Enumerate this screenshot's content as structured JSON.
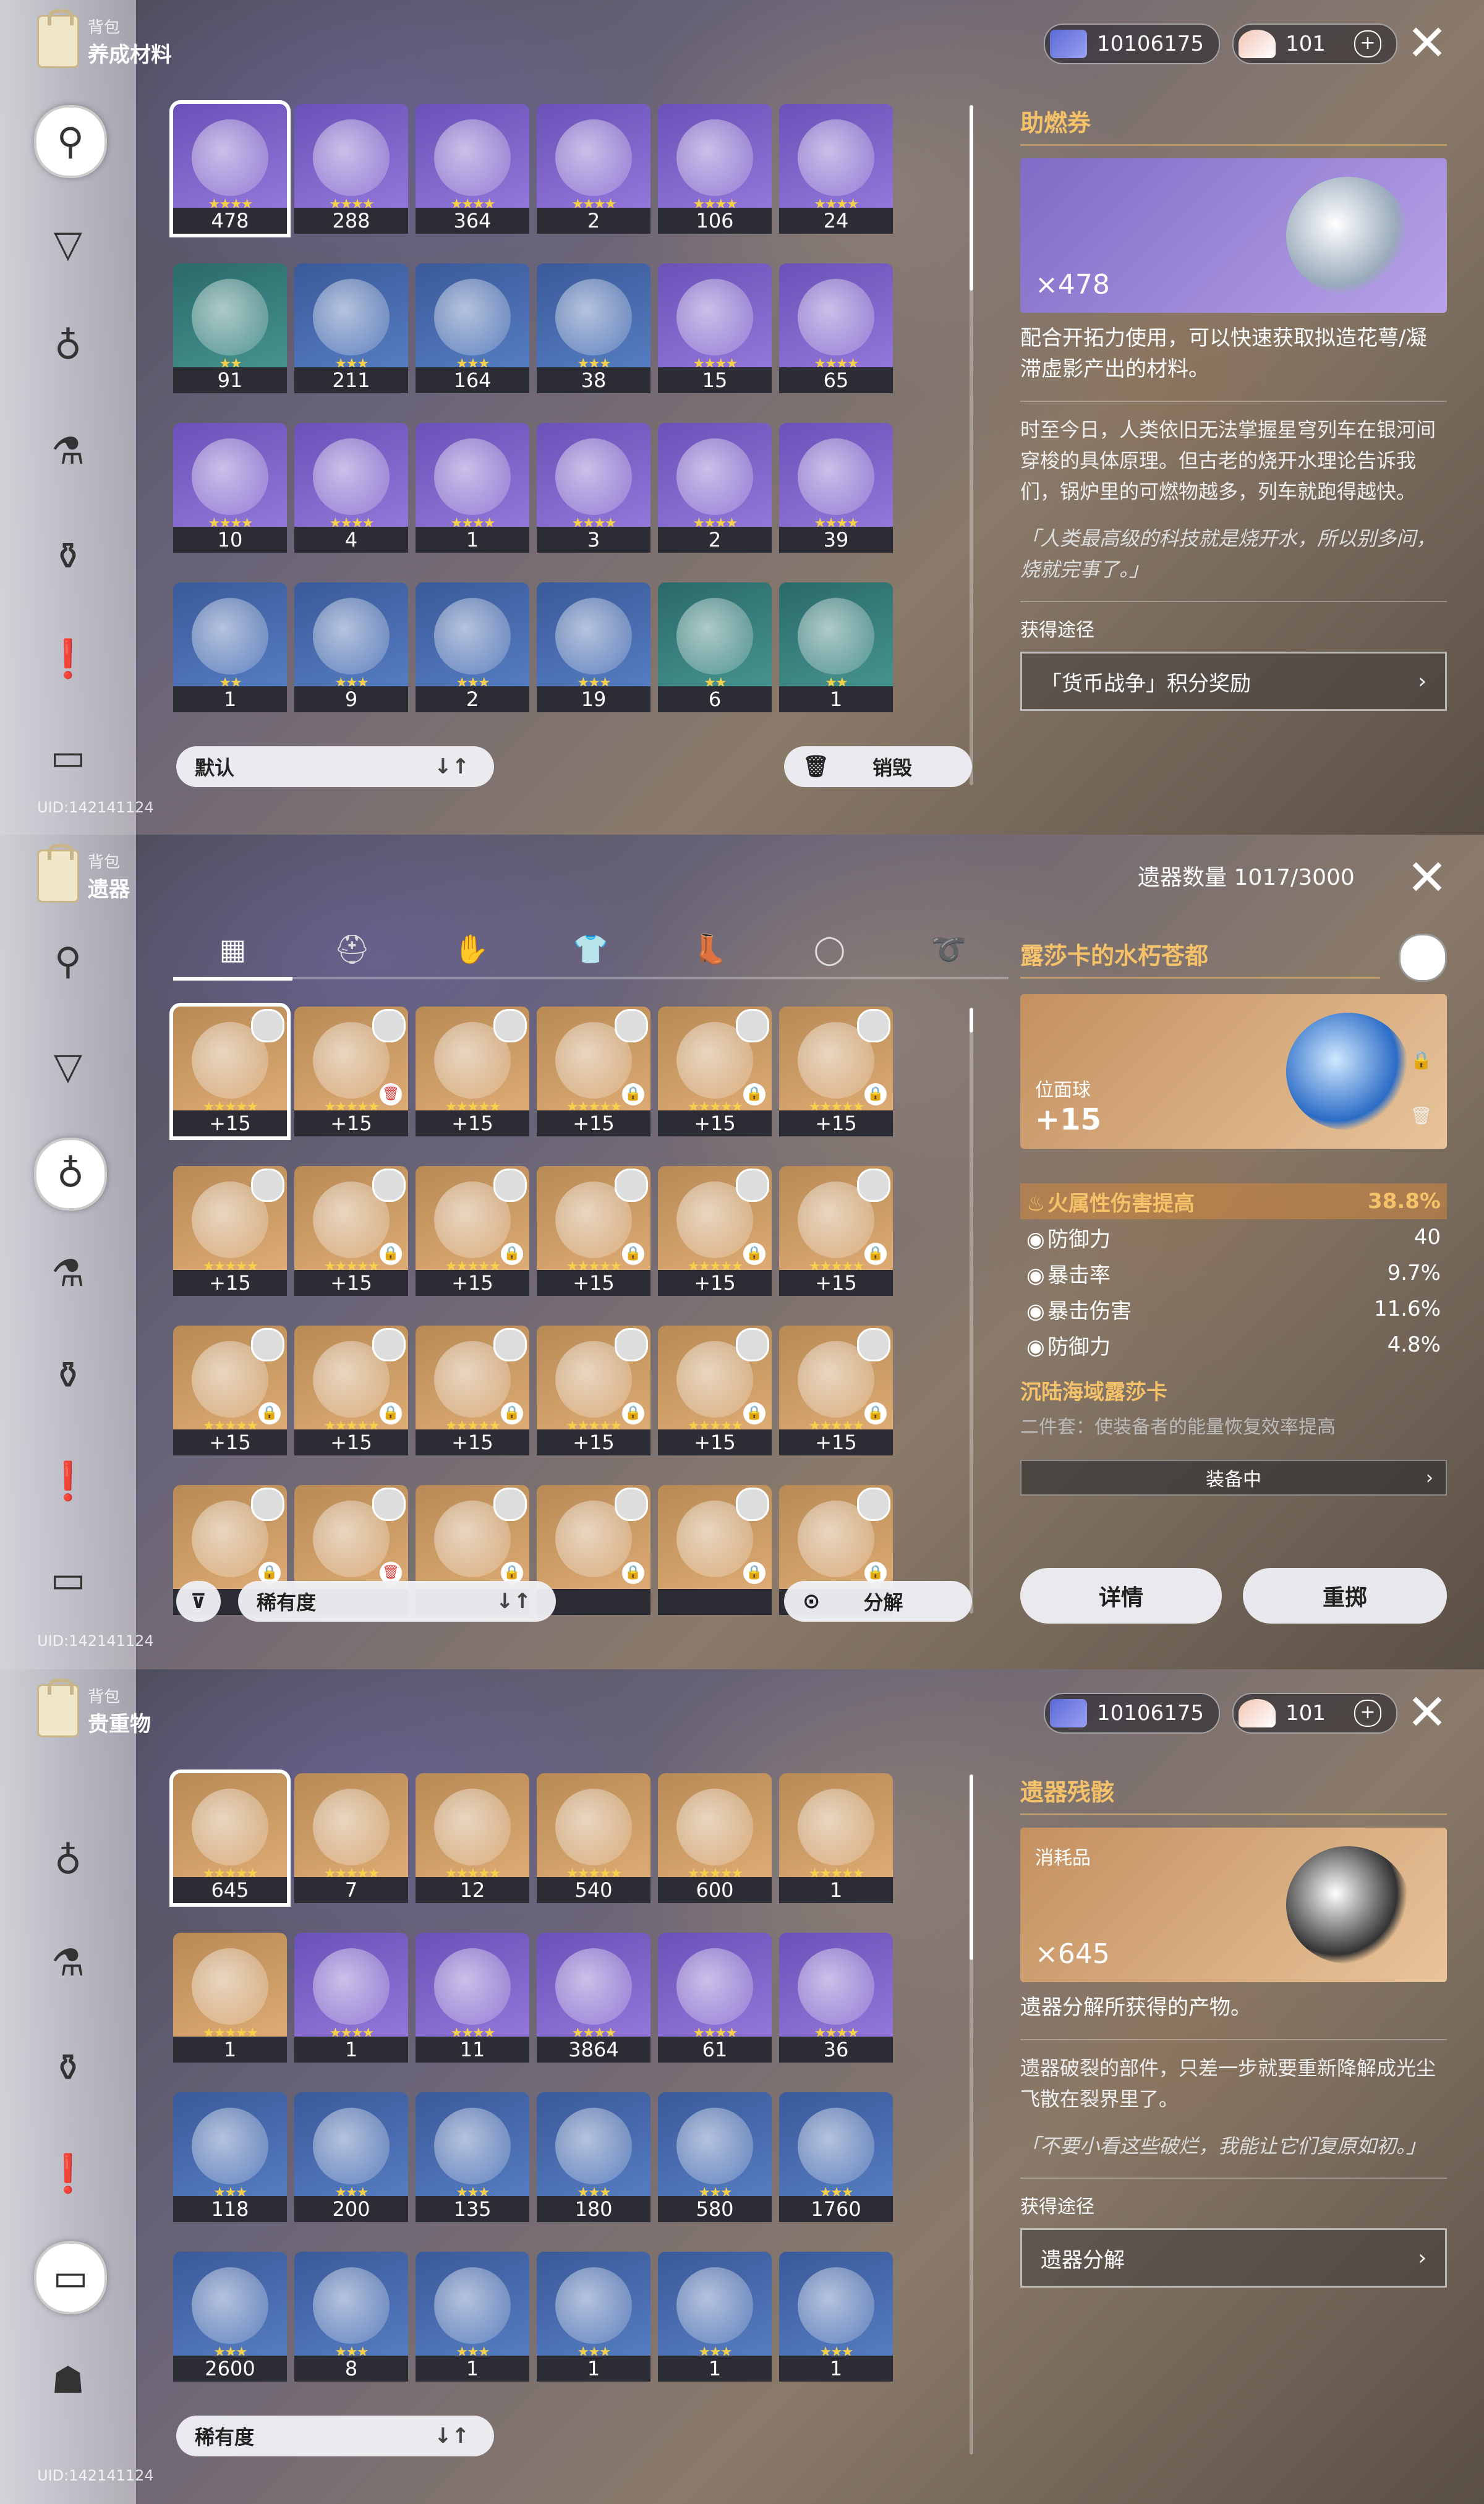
{
  "panel1": {
    "header": {
      "sub": "背包",
      "title": "养成材料"
    },
    "currency": {
      "credits": "10106175",
      "jade": "101",
      "plus": "+"
    },
    "uid": "UID:142141124",
    "sort": {
      "label": "默认",
      "icon": "↓↑"
    },
    "destroy": {
      "label": "销毁"
    },
    "items": [
      {
        "count": "478",
        "rarity": "r4",
        "stars": "★★★★"
      },
      {
        "count": "288",
        "rarity": "r4",
        "stars": "★★★★"
      },
      {
        "count": "364",
        "rarity": "r4",
        "stars": "★★★★"
      },
      {
        "count": "2",
        "rarity": "r4",
        "stars": "★★★★"
      },
      {
        "count": "106",
        "rarity": "r4",
        "stars": "★★★★"
      },
      {
        "count": "24",
        "rarity": "r4",
        "stars": "★★★★"
      },
      {
        "count": "91",
        "rarity": "r2",
        "stars": "★★"
      },
      {
        "count": "211",
        "rarity": "r3",
        "stars": "★★★"
      },
      {
        "count": "164",
        "rarity": "r3",
        "stars": "★★★"
      },
      {
        "count": "38",
        "rarity": "r3",
        "stars": "★★★"
      },
      {
        "count": "15",
        "rarity": "r4",
        "stars": "★★★★"
      },
      {
        "count": "65",
        "rarity": "r4",
        "stars": "★★★★"
      },
      {
        "count": "10",
        "rarity": "r4",
        "stars": "★★★★"
      },
      {
        "count": "4",
        "rarity": "r4",
        "stars": "★★★★"
      },
      {
        "count": "1",
        "rarity": "r4",
        "stars": "★★★★"
      },
      {
        "count": "3",
        "rarity": "r4",
        "stars": "★★★★"
      },
      {
        "count": "2",
        "rarity": "r4",
        "stars": "★★★★"
      },
      {
        "count": "39",
        "rarity": "r4",
        "stars": "★★★★"
      },
      {
        "count": "1",
        "rarity": "r3",
        "stars": "★★"
      },
      {
        "count": "9",
        "rarity": "r3",
        "stars": "★★★"
      },
      {
        "count": "2",
        "rarity": "r3",
        "stars": "★★★"
      },
      {
        "count": "19",
        "rarity": "r3",
        "stars": "★★★"
      },
      {
        "count": "6",
        "rarity": "r2",
        "stars": "★★"
      },
      {
        "count": "1",
        "rarity": "r2",
        "stars": "★★"
      }
    ],
    "detail": {
      "title": "助燃券",
      "qty": "×478",
      "text": "配合开拓力使用，可以快速获取拟造花萼/凝滞虚影产出的材料。",
      "lore": "时至今日，人类依旧无法掌握星穹列车在银河间穿梭的具体原理。但古老的烧开水理论告诉我们，锅炉里的可燃物越多，列车就跑得越快。",
      "quote": "「人类最高级的科技就是烧开水，所以别多问，烧就完事了。」",
      "source_label": "获得途径",
      "source_btn": "「货币战争」积分奖励",
      "chev": "›"
    }
  },
  "panel2": {
    "header": {
      "sub": "背包",
      "title": "遗器"
    },
    "count_label": "遗器数量 1017/3000",
    "uid": "UID:142141124",
    "tabs": [
      {
        "name": "all",
        "icon": "▦"
      },
      {
        "name": "head",
        "icon": "⛑"
      },
      {
        "name": "hands",
        "icon": "✋"
      },
      {
        "name": "body",
        "icon": "👕"
      },
      {
        "name": "feet",
        "icon": "👢"
      },
      {
        "name": "sphere",
        "icon": "◯"
      },
      {
        "name": "rope",
        "icon": "➰"
      }
    ],
    "sort": {
      "label": "稀有度",
      "icon": "↓↑"
    },
    "salvage": {
      "label": "分解"
    },
    "items": [
      {
        "count": "+15",
        "rarity": "r5",
        "stars": "★★★★★",
        "badge": ""
      },
      {
        "count": "+15",
        "rarity": "r5",
        "stars": "★★★★★",
        "badge": "🗑"
      },
      {
        "count": "+15",
        "rarity": "r5",
        "stars": "★★★★★",
        "badge": ""
      },
      {
        "count": "+15",
        "rarity": "r5",
        "stars": "★★★★★",
        "badge": "🔒"
      },
      {
        "count": "+15",
        "rarity": "r5",
        "stars": "★★★★★",
        "badge": "🔒"
      },
      {
        "count": "+15",
        "rarity": "r5",
        "stars": "★★★★★",
        "badge": "🔒"
      },
      {
        "count": "+15",
        "rarity": "r5",
        "stars": "★★★★★",
        "badge": ""
      },
      {
        "count": "+15",
        "rarity": "r5",
        "stars": "★★★★★",
        "badge": "🔒"
      },
      {
        "count": "+15",
        "rarity": "r5",
        "stars": "★★★★★",
        "badge": "🔒"
      },
      {
        "count": "+15",
        "rarity": "r5",
        "stars": "★★★★★",
        "badge": "🔒"
      },
      {
        "count": "+15",
        "rarity": "r5",
        "stars": "★★★★★",
        "badge": "🔒"
      },
      {
        "count": "+15",
        "rarity": "r5",
        "stars": "★★★★★",
        "badge": "🔒"
      },
      {
        "count": "+15",
        "rarity": "r5",
        "stars": "★★★★★",
        "badge": "🔒"
      },
      {
        "count": "+15",
        "rarity": "r5",
        "stars": "★★★★★",
        "badge": "🔒"
      },
      {
        "count": "+15",
        "rarity": "r5",
        "stars": "★★★★★",
        "badge": "🔒"
      },
      {
        "count": "+15",
        "rarity": "r5",
        "stars": "★★★★★",
        "badge": "🔒"
      },
      {
        "count": "+15",
        "rarity": "r5",
        "stars": "★★★★★",
        "badge": "🔒"
      },
      {
        "count": "+15",
        "rarity": "r5",
        "stars": "★★★★★",
        "badge": "🔒"
      },
      {
        "count": "",
        "rarity": "r5",
        "stars": "",
        "badge": "🔒"
      },
      {
        "count": "",
        "rarity": "r5",
        "stars": "",
        "badge": "🗑"
      },
      {
        "count": "",
        "rarity": "r5",
        "stars": "",
        "badge": "🔒"
      },
      {
        "count": "",
        "rarity": "r5",
        "stars": "",
        "badge": "🔒"
      },
      {
        "count": "",
        "rarity": "r5",
        "stars": "",
        "badge": "🔒"
      },
      {
        "count": "",
        "rarity": "r5",
        "stars": "",
        "badge": "🔒"
      }
    ],
    "detail": {
      "title": "露莎卡的水朽苍都",
      "slot": "位面球",
      "level": "+15",
      "main_stat": {
        "name": "火属性伤害提高",
        "value": "38.8%"
      },
      "sub_stats": [
        {
          "name": "防御力",
          "value": "40"
        },
        {
          "name": "暴击率",
          "value": "9.7%"
        },
        {
          "name": "暴击伤害",
          "value": "11.6%"
        },
        {
          "name": "防御力",
          "value": "4.8%"
        }
      ],
      "set_name": "沉陆海域露莎卡",
      "set_desc": "二件套：使装备者的能量恢复效率提高",
      "equipped": "装备中",
      "btn_details": "详情",
      "btn_reroll": "重掷",
      "chev": "›"
    }
  },
  "panel3": {
    "header": {
      "sub": "背包",
      "title": "贵重物"
    },
    "currency": {
      "credits": "10106175",
      "jade": "101",
      "plus": "+"
    },
    "uid": "UID:142141124",
    "sort": {
      "label": "稀有度",
      "icon": "↓↑"
    },
    "items": [
      {
        "count": "645",
        "rarity": "r5",
        "stars": "★★★★★"
      },
      {
        "count": "7",
        "rarity": "r5",
        "stars": "★★★★★"
      },
      {
        "count": "12",
        "rarity": "r5",
        "stars": "★★★★★"
      },
      {
        "count": "540",
        "rarity": "r5",
        "stars": "★★★★★"
      },
      {
        "count": "600",
        "rarity": "r5",
        "stars": "★★★★★"
      },
      {
        "count": "1",
        "rarity": "r5",
        "stars": "★★★★★"
      },
      {
        "count": "1",
        "rarity": "r5",
        "stars": "★★★★★"
      },
      {
        "count": "1",
        "rarity": "r4",
        "stars": "★★★★"
      },
      {
        "count": "11",
        "rarity": "r4",
        "stars": "★★★★"
      },
      {
        "count": "3864",
        "rarity": "r4",
        "stars": "★★★★"
      },
      {
        "count": "61",
        "rarity": "r4",
        "stars": "★★★★"
      },
      {
        "count": "36",
        "rarity": "r4",
        "stars": "★★★★"
      },
      {
        "count": "118",
        "rarity": "r3",
        "stars": "★★★"
      },
      {
        "count": "200",
        "rarity": "r3",
        "stars": "★★★"
      },
      {
        "count": "135",
        "rarity": "r3",
        "stars": "★★★"
      },
      {
        "count": "180",
        "rarity": "r3",
        "stars": "★★★"
      },
      {
        "count": "580",
        "rarity": "r3",
        "stars": "★★★"
      },
      {
        "count": "1760",
        "rarity": "r3",
        "stars": "★★★"
      },
      {
        "count": "2600",
        "rarity": "r3",
        "stars": "★★★"
      },
      {
        "count": "8",
        "rarity": "r3",
        "stars": "★★★"
      },
      {
        "count": "1",
        "rarity": "r3",
        "stars": "★★★"
      },
      {
        "count": "1",
        "rarity": "r3",
        "stars": "★★★"
      },
      {
        "count": "1",
        "rarity": "r3",
        "stars": "★★★"
      },
      {
        "count": "1",
        "rarity": "r3",
        "stars": "★★★"
      }
    ],
    "detail": {
      "title": "遗器残骸",
      "tag": "消耗品",
      "qty": "×645",
      "text": "遗器分解所获得的产物。",
      "lore": "遗器破裂的部件，只差一步就要重新降解成光尘飞散在裂界里了。",
      "quote": "「不要小看这些破烂，我能让它们复原如初。」",
      "source_label": "获得途径",
      "source_btn": "遗器分解",
      "chev": "›"
    }
  },
  "nav": {
    "icons": [
      "key-icon",
      "filter-icon",
      "relic-icon",
      "tool-icon",
      "flask-icon",
      "mission-icon",
      "valuable-icon",
      "bug-icon"
    ]
  },
  "glyphs": {
    "close": "✕",
    "filter": "⊽",
    "salvage": "⊙",
    "trash": "🗑",
    "lock": "🔒"
  }
}
